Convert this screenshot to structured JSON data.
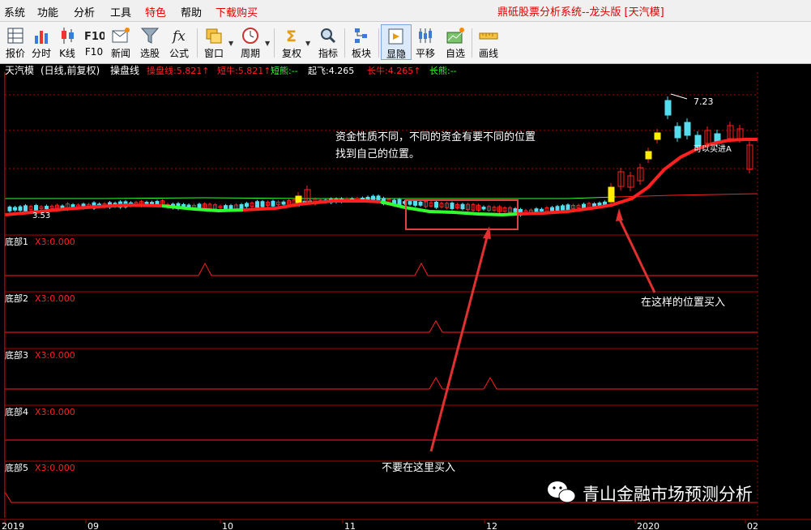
{
  "menu": {
    "items": [
      {
        "label": "系统",
        "highlight": false
      },
      {
        "label": "功能",
        "highlight": false
      },
      {
        "label": "分析",
        "highlight": false
      },
      {
        "label": "工具",
        "highlight": false
      },
      {
        "label": "特色",
        "highlight": true
      },
      {
        "label": "帮助",
        "highlight": false
      },
      {
        "label": "下载购买",
        "highlight": true
      }
    ],
    "app_title": "鼎砥股票分析系统--龙头版 [天汽模]"
  },
  "toolbar": {
    "buttons": [
      {
        "label": "报价",
        "icon": "grid-icon"
      },
      {
        "label": "分时",
        "icon": "bar-chart-icon"
      },
      {
        "label": "K线",
        "icon": "candlestick-icon"
      },
      {
        "label": "F10",
        "icon": "f10-icon"
      },
      {
        "label": "新闻",
        "icon": "news-icon"
      },
      {
        "label": "选股",
        "icon": "funnel-icon"
      },
      {
        "label": "公式",
        "icon": "formula-icon"
      },
      {
        "label": "窗口",
        "icon": "window-icon"
      },
      {
        "label": "周期",
        "icon": "clock-icon"
      },
      {
        "label": "复权",
        "icon": "sigma-icon"
      },
      {
        "label": "指标",
        "icon": "magnifier-icon"
      },
      {
        "label": "板块",
        "icon": "sector-icon"
      },
      {
        "label": "显隐",
        "icon": "show-hide-icon"
      },
      {
        "label": "平移",
        "icon": "pan-icon"
      },
      {
        "label": "自选",
        "icon": "favorites-icon"
      },
      {
        "label": "画线",
        "icon": "ruler-icon"
      }
    ]
  },
  "main_chart": {
    "header_name": "天汽模",
    "header_paren": "(日线,前复权)",
    "indicator_name": "操盘线",
    "values": [
      {
        "label": "操盘线:5.821↑",
        "color": "#ff2020"
      },
      {
        "label": "短牛:5.821↑",
        "color": "#ff2020"
      },
      {
        "label": "短熊:--",
        "color": "#30ff30"
      },
      {
        "label": "起飞:4.265",
        "color": "#ffffff"
      },
      {
        "label": "长牛:4.265↑",
        "color": "#ff2020"
      },
      {
        "label": "长熊:--",
        "color": "#30ff30"
      }
    ],
    "price_high_label": "7.23",
    "price_low_label": "3.53",
    "annotation_tag": "可以买进A"
  },
  "subcharts": [
    {
      "name": "底部1",
      "value": "X3:0.000"
    },
    {
      "name": "底部2",
      "value": "X3:0.000"
    },
    {
      "name": "底部3",
      "value": "X3:0.000"
    },
    {
      "name": "底部4",
      "value": "X3:0.000"
    },
    {
      "name": "底部5",
      "value": "X3:0.000"
    }
  ],
  "annotations": {
    "note_line1": "资金性质不同，不同的资金有要不同的位置",
    "note_line2": "找到自己的位置。",
    "buy_here": "在这样的位置买入",
    "dont_buy": "不要在这里买入"
  },
  "x_axis": {
    "ticks": [
      "2019",
      "09",
      "10",
      "11",
      "12",
      "2020",
      "02"
    ]
  },
  "watermark": "青山金融市场预测分析",
  "colors": {
    "up": "#ff2020",
    "down": "#30ff30",
    "cyan": "#55ddee",
    "yellow": "#ffee00",
    "background": "#000000"
  }
}
